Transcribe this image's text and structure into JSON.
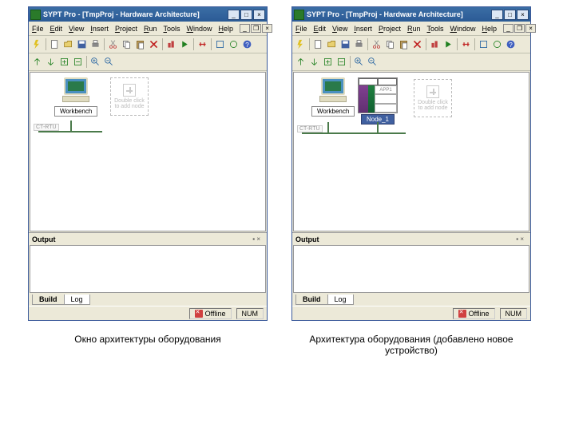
{
  "titlebar": {
    "text": "SYPT Pro - [TmpProj - Hardware Architecture]"
  },
  "menu": {
    "file": "File",
    "edit": "Edit",
    "view": "View",
    "insert": "Insert",
    "project": "Project",
    "run": "Run",
    "tools": "Tools",
    "window": "Window",
    "help": "Help"
  },
  "nodes": {
    "workbench": "Workbench",
    "node1": "Node_1",
    "app1": "APP1",
    "addnode": "Double click to add node",
    "net": "CT-RTU"
  },
  "output": {
    "title": "Output",
    "tab1": "Build",
    "tab2": "Log"
  },
  "status": {
    "offline": "Offline",
    "num": "NUM"
  },
  "captions": {
    "left": "Окно архитектуры оборудования",
    "right": "Архитектура оборудования (добавлено новое устройство)"
  }
}
